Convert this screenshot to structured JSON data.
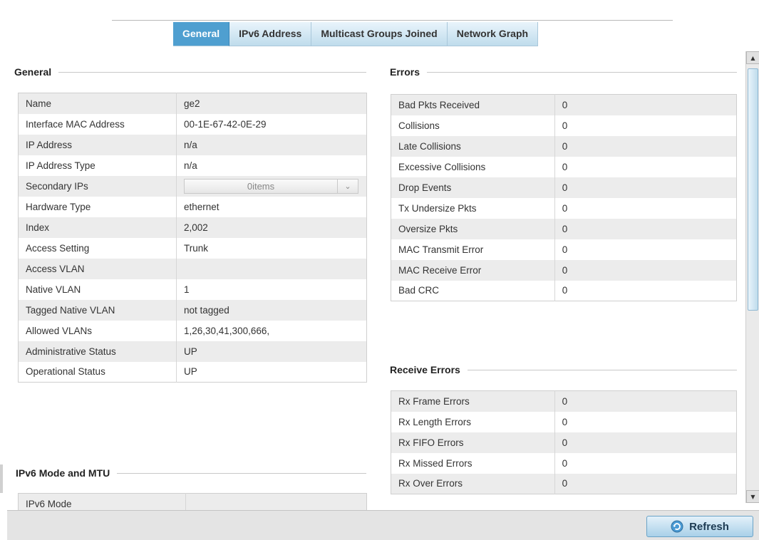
{
  "tabs": [
    {
      "label": "General",
      "active": true
    },
    {
      "label": "IPv6 Address",
      "active": false
    },
    {
      "label": "Multicast Groups Joined",
      "active": false
    },
    {
      "label": "Network Graph",
      "active": false
    }
  ],
  "general": {
    "title": "General",
    "rows": [
      {
        "label": "Name",
        "value": "ge2"
      },
      {
        "label": "Interface MAC Address",
        "value": "00-1E-67-42-0E-29"
      },
      {
        "label": "IP Address",
        "value": "n/a"
      },
      {
        "label": "IP Address Type",
        "value": "n/a"
      },
      {
        "label": "Secondary IPs",
        "value": "0items"
      },
      {
        "label": "Hardware Type",
        "value": "ethernet"
      },
      {
        "label": "Index",
        "value": "2,002"
      },
      {
        "label": "Access Setting",
        "value": "Trunk"
      },
      {
        "label": "Access VLAN",
        "value": ""
      },
      {
        "label": "Native VLAN",
        "value": "1"
      },
      {
        "label": "Tagged Native VLAN",
        "value": "not tagged"
      },
      {
        "label": "Allowed VLANs",
        "value": "1,26,30,41,300,666,"
      },
      {
        "label": "Administrative Status",
        "value": "UP"
      },
      {
        "label": "Operational Status",
        "value": "UP"
      }
    ]
  },
  "ipv6": {
    "title": "IPv6 Mode and MTU",
    "rows": [
      {
        "label": "IPv6 Mode",
        "value": ""
      }
    ]
  },
  "errors": {
    "title": "Errors",
    "rows": [
      {
        "label": "Bad Pkts Received",
        "value": "0"
      },
      {
        "label": "Collisions",
        "value": "0"
      },
      {
        "label": "Late Collisions",
        "value": "0"
      },
      {
        "label": "Excessive Collisions",
        "value": "0"
      },
      {
        "label": "Drop Events",
        "value": "0"
      },
      {
        "label": "Tx Undersize Pkts",
        "value": "0"
      },
      {
        "label": "Oversize Pkts",
        "value": "0"
      },
      {
        "label": "MAC Transmit Error",
        "value": "0"
      },
      {
        "label": "MAC Receive Error",
        "value": "0"
      },
      {
        "label": "Bad CRC",
        "value": "0"
      }
    ]
  },
  "receive_errors": {
    "title": "Receive Errors",
    "rows": [
      {
        "label": "Rx Frame Errors",
        "value": "0"
      },
      {
        "label": "Rx Length Errors",
        "value": "0"
      },
      {
        "label": "Rx FIFO Errors",
        "value": "0"
      },
      {
        "label": "Rx Missed Errors",
        "value": "0"
      },
      {
        "label": "Rx Over Errors",
        "value": "0"
      }
    ]
  },
  "footer": {
    "refresh_label": "Refresh",
    "refresh_icon": "refresh-icon"
  }
}
